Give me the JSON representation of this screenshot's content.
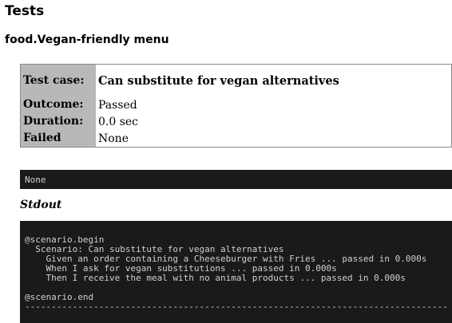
{
  "page_title": "Tests",
  "suite_title": "food.Vegan-friendly menu",
  "result": {
    "test_case_label": "Test case:",
    "test_case_value": "Can substitute for vegan alternatives",
    "outcome_label": "Outcome:",
    "outcome_value": "Passed",
    "duration_label": "Duration:",
    "duration_value": "0.0 sec",
    "failed_label": "Failed",
    "failed_value": "None"
  },
  "failure_output": "None",
  "stdout_label": "Stdout",
  "stdout_lines": [
    "@scenario.begin",
    "  Scenario: Can substitute for vegan alternatives",
    "    Given an order containing a Cheeseburger with Fries ... passed in 0.000s",
    "    When I ask for vegan substitutions ... passed in 0.000s",
    "    Then I receive the meal with no animal products ... passed in 0.000s",
    "",
    "@scenario.end",
    "--------------------------------------------------------------------------------"
  ]
}
